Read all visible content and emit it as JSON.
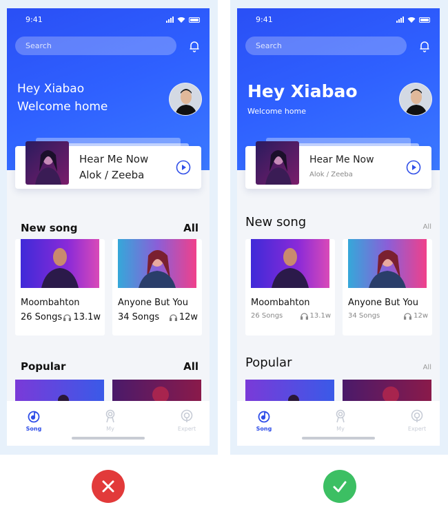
{
  "status": {
    "time": "9:41"
  },
  "search": {
    "placeholder": "Search"
  },
  "greeting": {
    "line1": "Hey Xiabao",
    "line2": "Welcome home"
  },
  "now_playing": {
    "title": "Hear Me Now",
    "artist": "Alok / Zeeba"
  },
  "new_song": {
    "title": "New song",
    "all": "All",
    "cards": [
      {
        "name": "Moombahton",
        "count": "26 Songs",
        "plays": "13.1w"
      },
      {
        "name": "Anyone But You",
        "count": "34 Songs",
        "plays": "12w"
      }
    ]
  },
  "popular": {
    "title": "Popular",
    "all": "All"
  },
  "tabs": [
    {
      "label": "Song",
      "active": true,
      "icon": "music-note-icon"
    },
    {
      "label": "My",
      "active": false,
      "icon": "person-icon"
    },
    {
      "label": "Expert",
      "active": false,
      "icon": "podcast-icon"
    }
  ],
  "verdict": {
    "left": "cross-icon",
    "right": "check-icon"
  },
  "colors": {
    "accent": "#2f4ee8",
    "bad": "#e23a3a",
    "good": "#3cbf63"
  }
}
